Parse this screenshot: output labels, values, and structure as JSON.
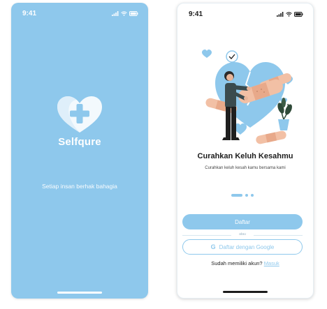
{
  "splash": {
    "status_time": "9:41",
    "brand_name": "Selfqure",
    "tagline": "Setiap insan berhak bahagia"
  },
  "onboarding": {
    "status_time": "9:41",
    "title": "Curahkan Keluh Kesahmu",
    "subtitle": "Curahkan keluh kesah kamu bersama kami",
    "pagination": {
      "total": 3,
      "active_index": 0
    },
    "primary_button": "Daftar",
    "divider_text": "atau",
    "google_button": "Daftar dengan Google",
    "google_icon": "google-g-icon",
    "login_prompt": "Sudah memiliki akun?",
    "login_link": "Masuk"
  },
  "colors": {
    "brand_blue": "#8ec8ec",
    "text_dark": "#1c1c1c",
    "white": "#ffffff"
  }
}
